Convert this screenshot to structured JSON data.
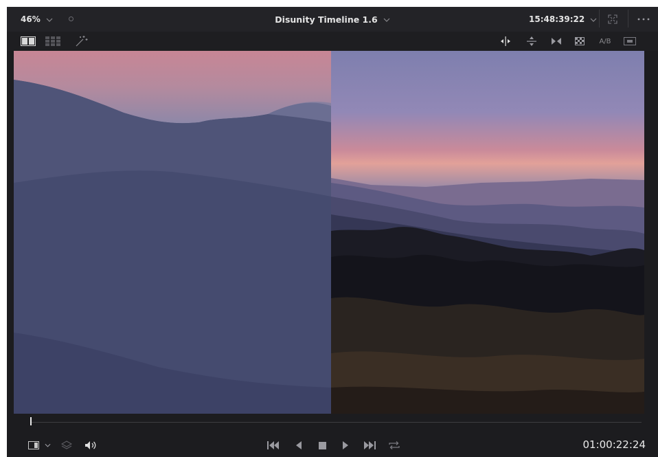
{
  "topbar": {
    "zoom": "46%",
    "title": "Disunity Timeline 1.6",
    "timecode": "15:48:39:22"
  },
  "toolbar": {
    "ab_label": "A/B"
  },
  "transport": {
    "timecode": "01:00:22:24"
  },
  "icons": {
    "split_view": "split-view-icon",
    "grid_view": "grid-view-icon",
    "magic": "magic-wand-icon",
    "wipe_vertical": "wipe-vertical-icon",
    "wipe_horizontal": "wipe-horizontal-icon",
    "wipe_mix": "wipe-mix-icon",
    "checker": "checkerboard-icon",
    "safe_area": "safe-area-icon",
    "fullscreen": "fullscreen-icon",
    "more": "more-options-icon"
  },
  "colors": {
    "accent": "#e4e4e4",
    "background": "#1c1c1f"
  }
}
